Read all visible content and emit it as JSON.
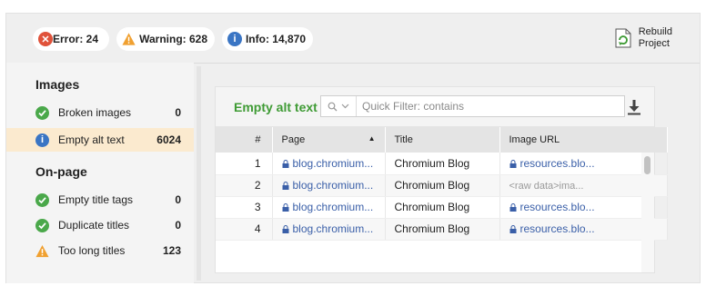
{
  "status": {
    "error": {
      "label": "Error: 24",
      "color": "#e0523a",
      "icon": "error-x-icon"
    },
    "warning": {
      "label": "Warning: 628",
      "color": "#f0a030",
      "icon": "warning-triangle-icon"
    },
    "info": {
      "label": "Info: 14,870",
      "color": "#3a75c4",
      "icon": "info-icon"
    }
  },
  "rebuild": {
    "line1": "Rebuild",
    "line2": "Project",
    "icon": "rebuild-project-icon"
  },
  "sidebar": {
    "sections": [
      {
        "heading": "Images",
        "items": [
          {
            "label": "Broken images",
            "count": "0",
            "status": "ok"
          },
          {
            "label": "Empty alt text",
            "count": "6024",
            "status": "info",
            "active": true
          }
        ]
      },
      {
        "heading": "On-page",
        "items": [
          {
            "label": "Empty title tags",
            "count": "0",
            "status": "ok"
          },
          {
            "label": "Duplicate titles",
            "count": "0",
            "status": "ok"
          },
          {
            "label": "Too long titles",
            "count": "123",
            "status": "warning"
          }
        ]
      }
    ]
  },
  "panel": {
    "title": "Empty alt text",
    "filter_placeholder": "Quick Filter: contains",
    "columns": [
      "#",
      "Page",
      "Title",
      "Image URL"
    ],
    "sort_indicator": "▲",
    "rows": [
      {
        "n": "1",
        "page": "blog.chromium...",
        "title": "Chromium Blog",
        "image": "resources.blo...",
        "image_secure": true
      },
      {
        "n": "2",
        "page": "blog.chromium...",
        "title": "Chromium Blog",
        "image": "<raw data>ima...",
        "image_secure": false
      },
      {
        "n": "3",
        "page": "blog.chromium...",
        "title": "Chromium Blog",
        "image": "resources.blo...",
        "image_secure": true
      },
      {
        "n": "4",
        "page": "blog.chromium...",
        "title": "Chromium Blog",
        "image": "resources.blo...",
        "image_secure": true
      }
    ]
  },
  "colors": {
    "ok": "#4aa84a",
    "accent_green": "#3f9b35",
    "link": "#3a5fa8"
  }
}
